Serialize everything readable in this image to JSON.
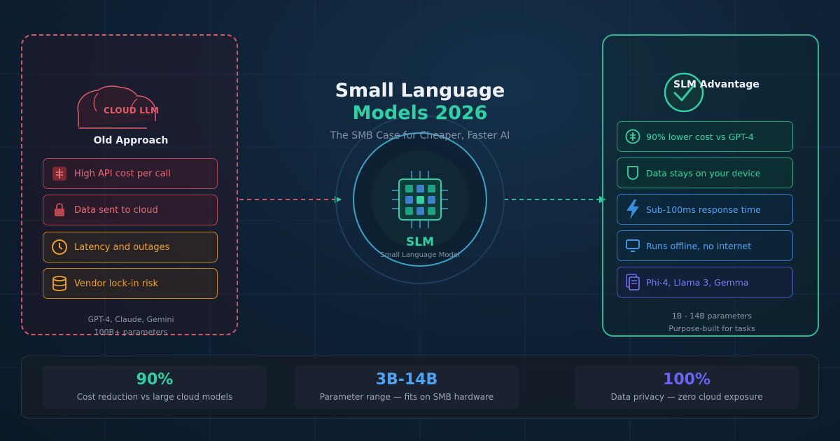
{
  "header": {
    "title_line1": "Small Language",
    "title_line2": "Models 2026",
    "subtitle": "The SMB Case for Cheaper, Faster AI"
  },
  "left_panel": {
    "cloud_label": "CLOUD LLM",
    "title": "Old Approach",
    "items": [
      {
        "label": "High API cost per call",
        "icon": "dollar-icon"
      },
      {
        "label": "Data sent to cloud",
        "icon": "lock-icon"
      },
      {
        "label": "Latency and outages",
        "icon": "clock-icon"
      },
      {
        "label": "Vendor lock-in risk",
        "icon": "database-icon"
      }
    ],
    "footer_line1": "GPT-4, Claude, Gemini",
    "footer_line2": "100B+ parameters"
  },
  "center": {
    "label": "SLM",
    "sublabel": "Small Language Model",
    "icon": "chip-icon"
  },
  "right_panel": {
    "title": "SLM Advantage",
    "items": [
      {
        "label": "90% lower cost vs GPT-4",
        "icon": "dollar-icon"
      },
      {
        "label": "Data stays on your device",
        "icon": "shield-icon"
      },
      {
        "label": "Sub-100ms response time",
        "icon": "lightning-icon"
      },
      {
        "label": "Runs offline, no internet",
        "icon": "monitor-icon"
      },
      {
        "label": "Phi-4, Llama 3, Gemma",
        "icon": "stack-icon"
      }
    ],
    "footer_line1": "1B - 14B parameters",
    "footer_line2": "Purpose-built for tasks"
  },
  "stats": [
    {
      "value": "90%",
      "label": "Cost reduction vs large cloud models",
      "color": "#2fd0a4"
    },
    {
      "value": "3B-14B",
      "label": "Parameter range — fits on SMB hardware",
      "color": "#4ea2f2"
    },
    {
      "value": "100%",
      "label": "Data privacy — zero cloud exposure",
      "color": "#6c63f5"
    }
  ],
  "colors": {
    "red": "#e05c68",
    "orange": "#f0a02a",
    "green": "#2fd0a4",
    "blue": "#4ea2f2",
    "purple": "#7a7ff5"
  }
}
